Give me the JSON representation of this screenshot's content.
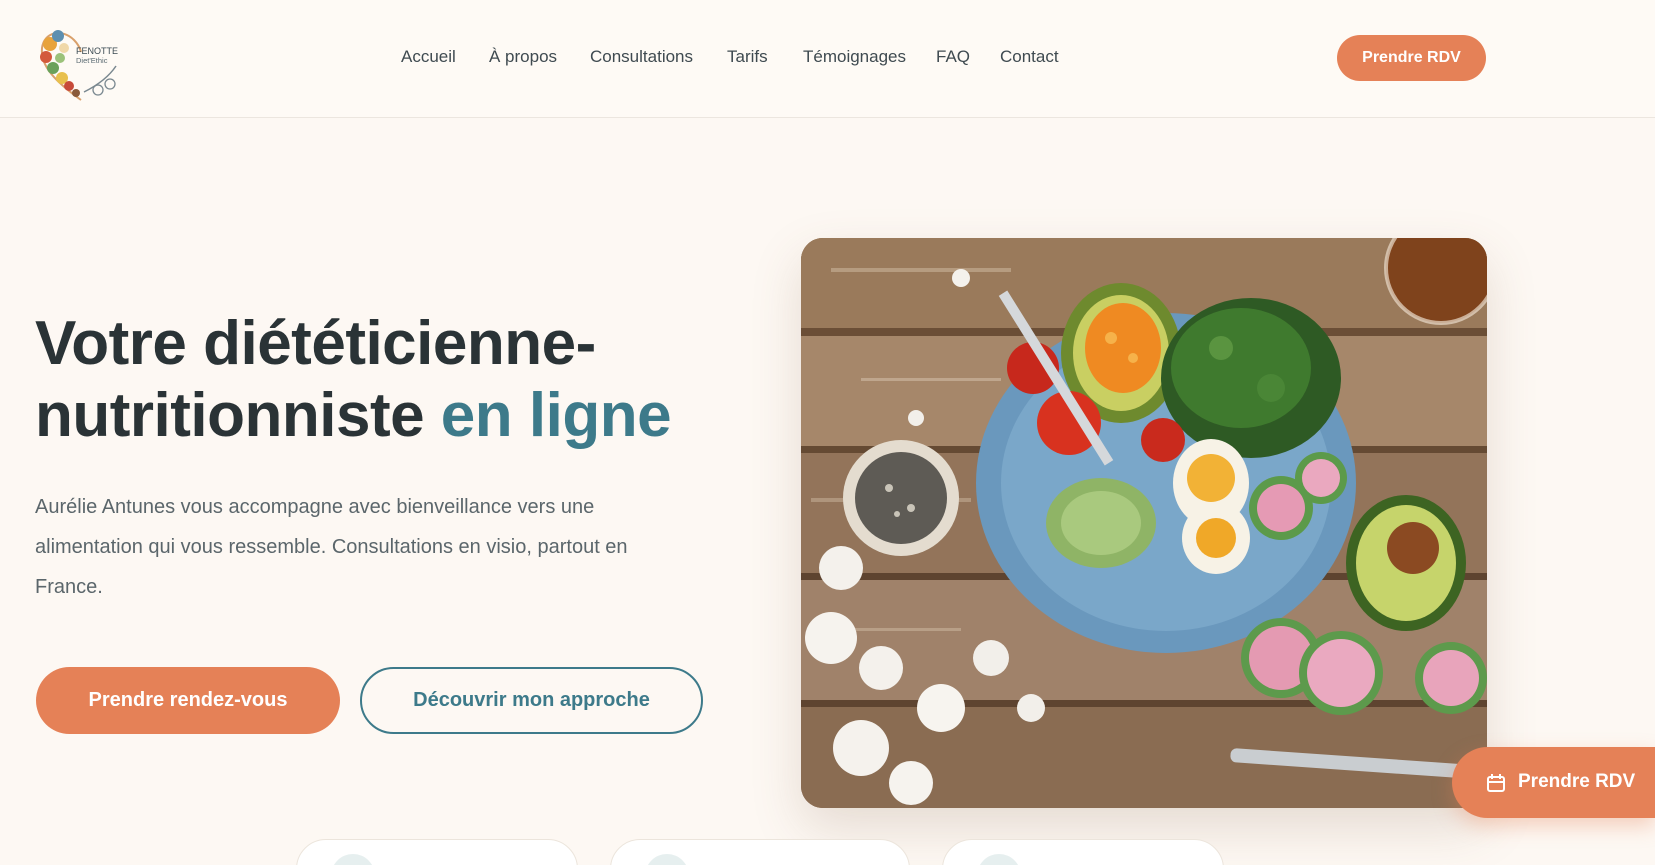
{
  "brand": {
    "name": "FENOTTE",
    "tagline": "Diet'Ethic"
  },
  "nav": {
    "items": [
      "Accueil",
      "À propos",
      "Consultations",
      "Tarifs",
      "Témoignages",
      "FAQ",
      "Contact"
    ],
    "cta_label": "Prendre RDV"
  },
  "hero": {
    "title_line1": "Votre diététicienne-",
    "title_line2_plain": "nutritionniste ",
    "title_line2_accent": "en ligne",
    "description": "Aurélie Antunes vous accompagne avec bienveillance vers une alimentation qui vous ressemble. Consultations en visio, partout en France.",
    "primary_button": "Prendre rendez-vous",
    "secondary_button": "Découvrir mon approche"
  },
  "floating_cta": {
    "label": "Prendre RDV",
    "icon": "calendar-icon"
  },
  "colors": {
    "accent": "#e58157",
    "teal": "#3d7a8a",
    "background": "#fdf8f3",
    "text": "#2a3336"
  },
  "icons": {
    "logo": "heart-food-logo"
  }
}
